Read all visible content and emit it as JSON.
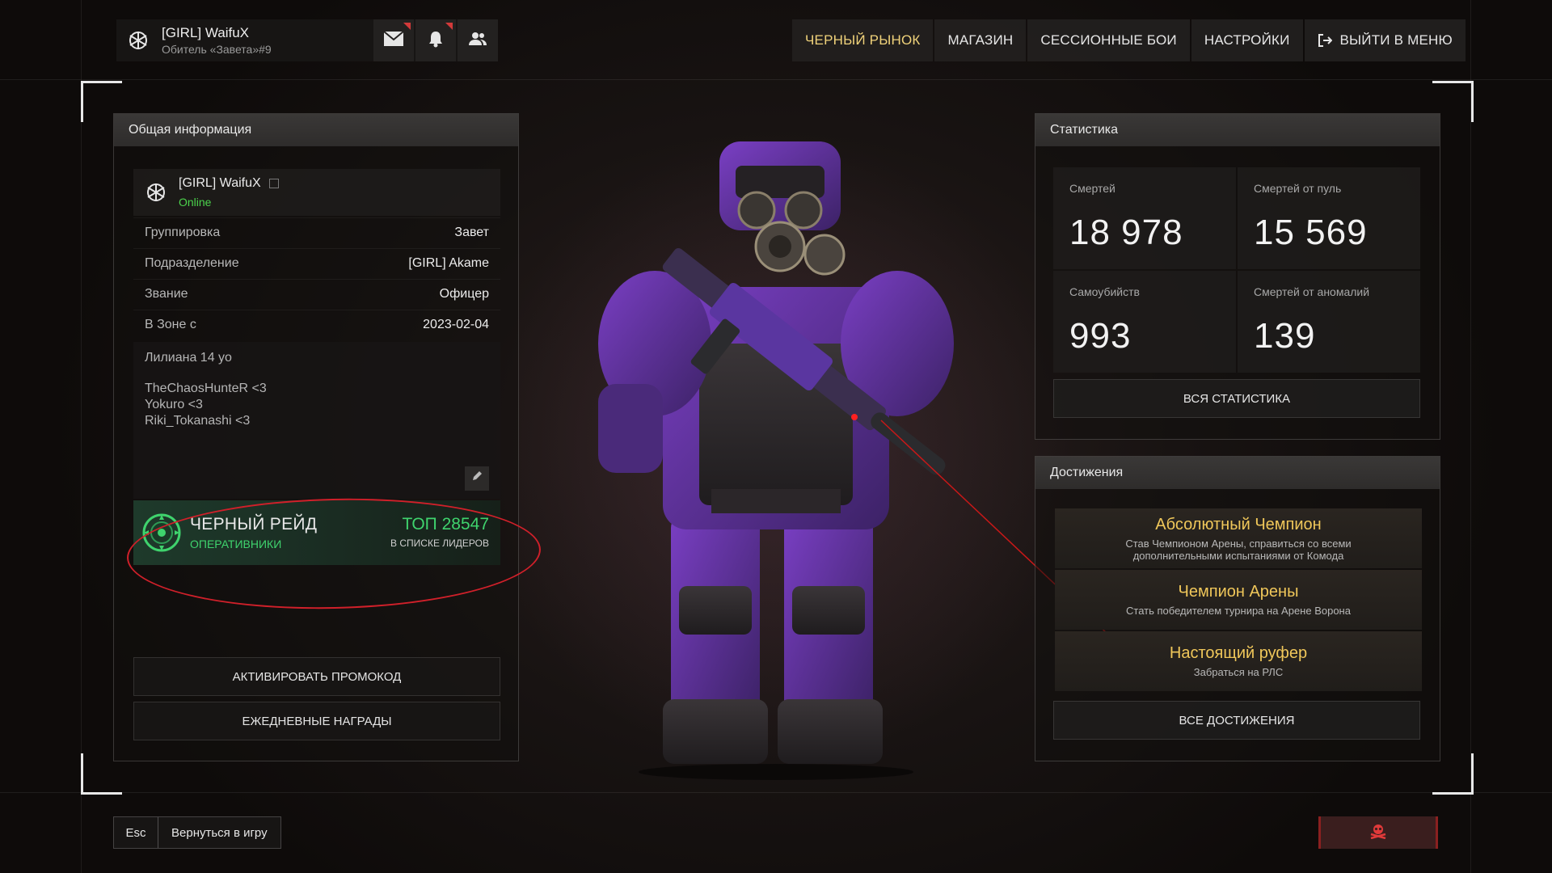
{
  "header": {
    "username": "[GIRL] WaifuX",
    "server": "Обитель «Завета»#9",
    "icons": [
      "emblem-icon",
      "mail-icon",
      "bell-icon",
      "friends-icon"
    ]
  },
  "nav": [
    {
      "label": "ЧЕРНЫЙ РЫНОК",
      "active": true
    },
    {
      "label": "МАГАЗИН",
      "active": false
    },
    {
      "label": "СЕССИОННЫЕ БОИ",
      "active": false
    },
    {
      "label": "НАСТРОЙКИ",
      "active": false
    },
    {
      "label": "ВЫЙТИ В МЕНЮ",
      "active": false
    }
  ],
  "profile": {
    "title": "Общая информация",
    "name": "[GIRL] WaifuX",
    "status": "Online",
    "rows": [
      {
        "key": "Группировка",
        "value": "Завет"
      },
      {
        "key": "Подразделение",
        "value": "[GIRL] Akame"
      },
      {
        "key": "Звание",
        "value": "Офицер"
      },
      {
        "key": "В Зоне с",
        "value": "2023-02-04"
      }
    ],
    "bio": {
      "line1": "Лилиана 14 yo",
      "lines": [
        "TheChaosHunteR <3",
        "Yokuro <3",
        "Riki_Tokanashi <3"
      ]
    },
    "raid": {
      "title": "ЧЕРНЫЙ РЕЙД",
      "subtitle": "ОПЕРАТИВНИКИ",
      "rank": "ТОП 28547",
      "rank_caption": "В СПИСКЕ ЛИДЕРОВ"
    },
    "promo_button": "АКТИВИРОВАТЬ ПРОМОКОД",
    "daily_button": "ЕЖЕДНЕВНЫЕ НАГРАДЫ"
  },
  "stats": {
    "title": "Статистика",
    "cells": [
      {
        "label": "Смертей",
        "value": "18 978"
      },
      {
        "label": "Смертей от пуль",
        "value": "15 569"
      },
      {
        "label": "Самоубийств",
        "value": "993"
      },
      {
        "label": "Смертей от аномалий",
        "value": "139"
      }
    ],
    "all_button": "ВСЯ СТАТИСТИКА"
  },
  "achievements": {
    "title": "Достижения",
    "items": [
      {
        "title": "Абсолютный Чемпион",
        "desc": "Став Чемпионом Арены, справиться со всеми дополнительными испытаниями от Комода"
      },
      {
        "title": "Чемпион Арены",
        "desc": "Стать победителем турнира на Арене Ворона"
      },
      {
        "title": "Настоящий руфер",
        "desc": "Забраться на РЛС"
      }
    ],
    "all_button": "ВСЕ ДОСТИЖЕНИЯ"
  },
  "footer": {
    "key": "Esc",
    "back_label": "Вернуться в игру"
  },
  "colors": {
    "accent_gold": "#f0c75a",
    "online_green": "#4cd34c",
    "raid_green": "#3fd36d",
    "highlight_red": "#d0202a"
  }
}
